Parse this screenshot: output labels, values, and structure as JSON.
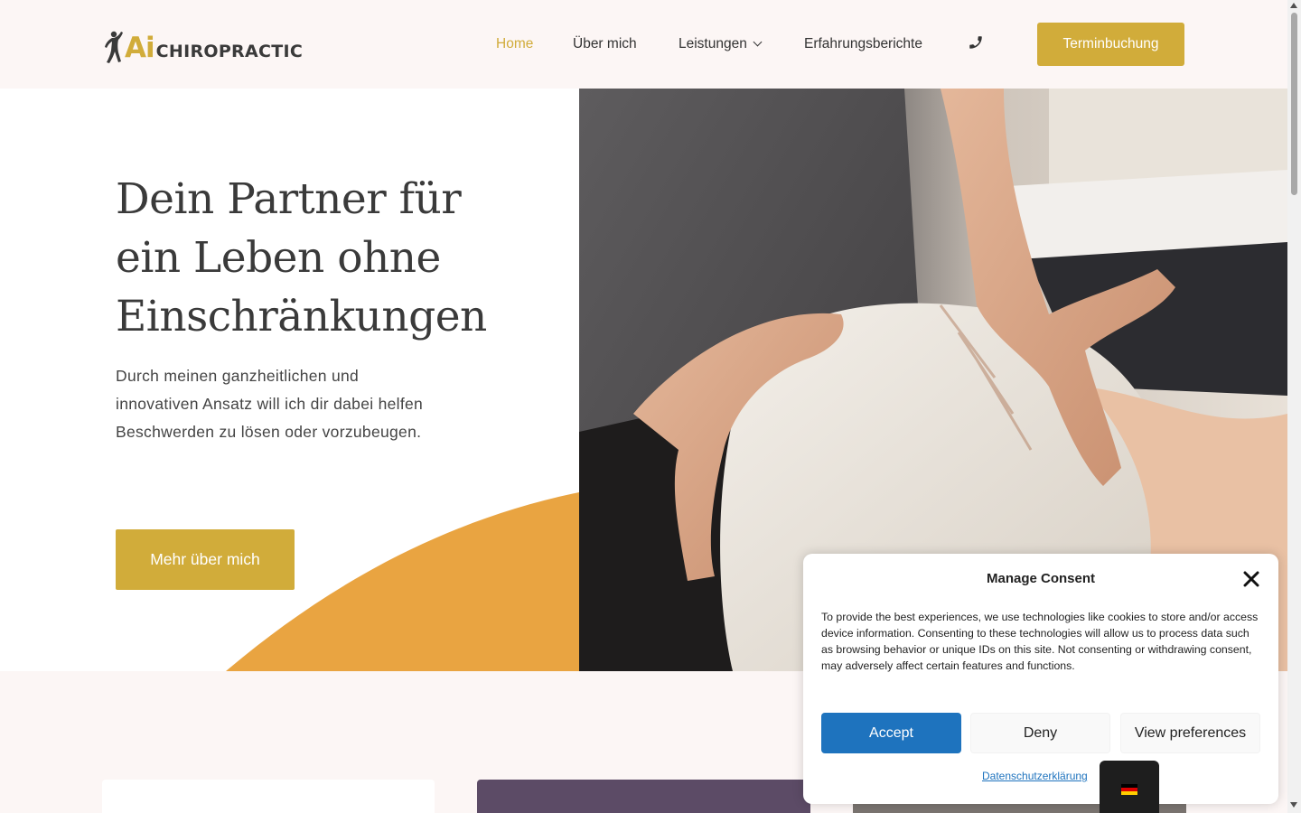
{
  "header": {
    "logo_ai": "Ai",
    "logo_chiropractic": "CHIROPRACTIC",
    "nav": [
      {
        "label": "Home",
        "active": true
      },
      {
        "label": "Über mich"
      },
      {
        "label": "Leistungen",
        "has_dropdown": true
      },
      {
        "label": "Erfahrungsberichte"
      }
    ],
    "phone_icon": "phone-icon",
    "cta_label": "Terminbuchung"
  },
  "hero": {
    "title": "Dein Partner für ein Leben ohne Einschränkungen",
    "text": "Durch meinen ganzheitlichen und innovativen Ansatz will ich dir dabei helfen Beschwerden zu lösen oder vorzubeugen.",
    "button_label": "Mehr über mich",
    "image": "chiropractor-hands-treating-patient-shoulder"
  },
  "consent": {
    "title": "Manage Consent",
    "text": "To provide the best experiences, we use technologies like cookies to store and/or access device information. Consenting to these technologies will allow us to process data such as browsing behavior or unique IDs on this site. Not consenting or withdrawing consent, may adversely affect certain features and functions.",
    "accept_label": "Accept",
    "deny_label": "Deny",
    "preferences_label": "View preferences",
    "policy_link": "Datenschutzerklärung"
  },
  "language": {
    "current": "de",
    "flag": "german-flag-icon"
  },
  "colors": {
    "brand_gold": "#d1ac3a",
    "accent_orange": "#e9a441",
    "accept_blue": "#1e73be",
    "background": "#fcf6f5",
    "card_purple": "#5c4b66"
  }
}
